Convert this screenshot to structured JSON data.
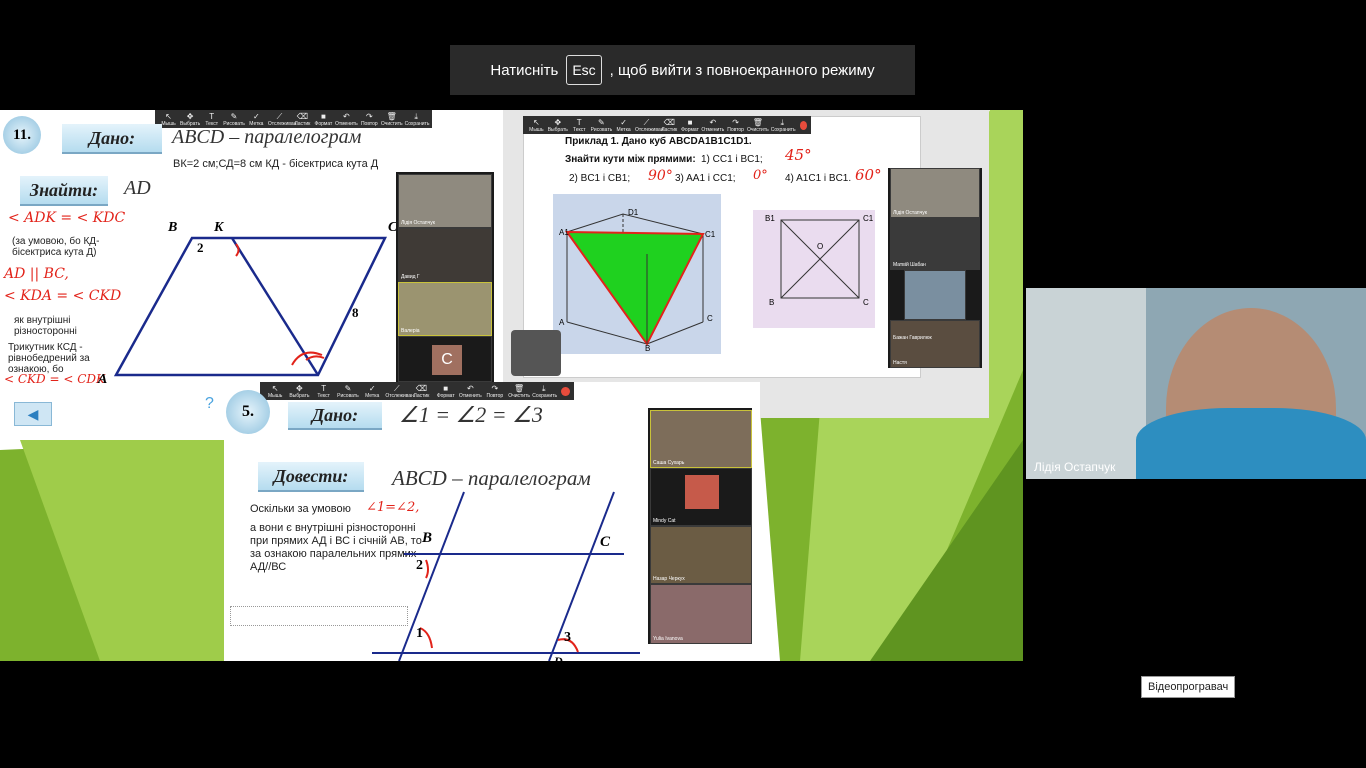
{
  "fullscreen_banner": {
    "prefix": "Натисніть",
    "key": "Esc",
    "suffix": ", щоб вийти з повноекранного режиму"
  },
  "toolbar_labels": [
    "Мышь",
    "Выбрать",
    "Текст",
    "Рисовать",
    "Метка",
    "Отслеживан.",
    "Ластик",
    "Формат",
    "Отменить",
    "Повтор",
    "Очистить",
    "Сохранить"
  ],
  "slide11": {
    "number": "11.",
    "given_label": "Дано:",
    "title": "ABCD – паралелограм",
    "conditions": "ВК=2 см;СД=8 см    КД - бісектриса кута Д",
    "find_label": "Знайти:",
    "find_value": "AD",
    "hand1": "< ADK = < KDC",
    "note1": "(за умовою, бо КД-бісектриса кута Д)",
    "hand2": "AD || BC,",
    "hand3": "< KDA = < CKD",
    "note2": "як внутрішні різносторонні",
    "note3": "Трикутник КСД - рівнобедрений за ознакою, бо",
    "hand4": "< CKD = < CDK",
    "vertex_b": "B",
    "vertex_k": "K",
    "vertex_c": "C",
    "vertex_a": "A",
    "label_2": "2",
    "label_8": "8",
    "question": "?"
  },
  "thumbs_left": [
    {
      "name": "Лідія Остапчук"
    },
    {
      "name": "Давид Г"
    },
    {
      "name": "Валеріа"
    },
    {
      "initial": "С"
    }
  ],
  "slide_cube": {
    "task": "Приклад 1. Дано куб ABCDA1B1C1D1.",
    "find": "Знайти кути між прямими:",
    "p1": "1) CC1 і BC1;",
    "a1": "45°",
    "p2": "2) BC1 і CB1;",
    "a2": "90°",
    "p3": "3) AA1 і CC1;",
    "a3": "0°",
    "p4": "4) A1C1 і BC1.",
    "a4": "60°",
    "labels": {
      "D1": "D1",
      "A1": "A1",
      "C1": "C1",
      "A": "A",
      "B": "B",
      "C": "C"
    },
    "square_labels": {
      "B1": "B1",
      "C1": "C1",
      "B": "B",
      "C": "C",
      "O": "O"
    }
  },
  "thumbs_mid": [
    {
      "name": "Лідія Остапчук"
    },
    {
      "name": "Матвій Шабан"
    },
    {
      "name": ""
    },
    {
      "name": "Бажан Гаврилюк"
    },
    {
      "name": "Настя"
    }
  ],
  "slide5": {
    "number": "5.",
    "given_label": "Дано:",
    "given_value": "∠1 = ∠2 = ∠3",
    "prove_label": "Довести:",
    "prove_value": "ABCD – паралелограм",
    "text1": "Оскільки за умовою",
    "hand1": "∠1=∠2,",
    "text2": "а вони є внутрішні різносторонні при прямих АД і ВС і січній АВ, то за ознакою паралельних прямих АД//ВС",
    "vertex_b": "B",
    "vertex_c": "C",
    "vertex_d": "D",
    "n1": "1",
    "n2": "2",
    "n3": "3"
  },
  "thumbs_bottom": [
    {
      "name": "Саша Сухарь"
    },
    {
      "name": "Mindy Cat"
    },
    {
      "name": "Назар Черкух"
    },
    {
      "name": "Yulia Ivanova"
    }
  ],
  "speaker": {
    "name": "Лідія Остапчук"
  },
  "tooltip": "Відеопрогравач",
  "colors": {
    "accent_green": "#7db22d",
    "marker_red": "#e2231a",
    "figure_green": "#1fd11f",
    "line_blue": "#1a2a8c"
  }
}
